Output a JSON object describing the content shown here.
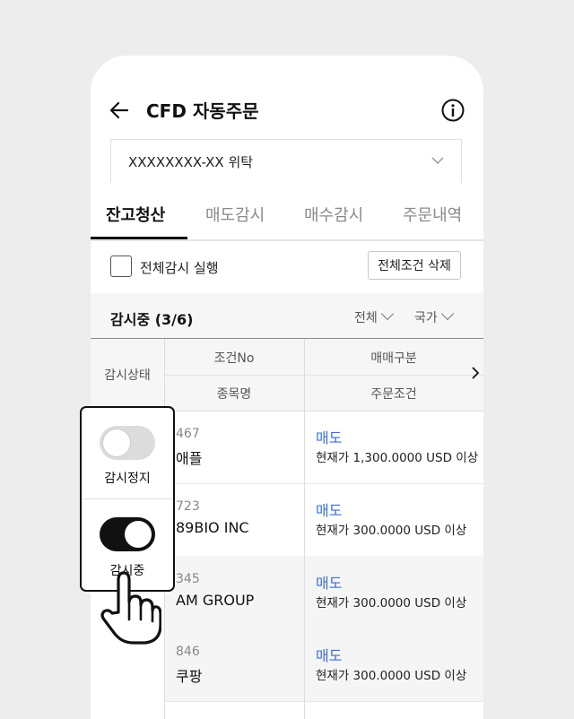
{
  "header": {
    "title": "CFD 자동주문",
    "back_icon": "arrow-left-icon",
    "info_icon": "info-circle-icon"
  },
  "account": {
    "value": "XXXXXXXX-XX 위탁"
  },
  "tabs": [
    {
      "label": "잔고청산",
      "active": true
    },
    {
      "label": "매도감시",
      "active": false
    },
    {
      "label": "매수감시",
      "active": false
    },
    {
      "label": "주문내역",
      "active": false
    }
  ],
  "controls": {
    "checkbox_label": "전체감시 실행",
    "delete_button": "전체조건 삭제"
  },
  "section": {
    "title": "감시중 (3/6)",
    "filter_all": "전체",
    "filter_country": "국가"
  },
  "table": {
    "headers": {
      "status": "감시상태",
      "cond_no": "조건No",
      "trade_type": "매매구분",
      "stock_name": "종목명",
      "order_cond": "주문조건"
    },
    "rows": [
      {
        "no": "467",
        "name": "애플",
        "type": "매도",
        "cond": "현재가 1,300.0000 USD 이상"
      },
      {
        "no": "723",
        "name": "89BIO INC",
        "type": "매도",
        "cond": "현재가 300.0000 USD 이상"
      },
      {
        "no": "345",
        "name": "AM GROUP",
        "type": "매도",
        "cond": "현재가 300.0000 USD 이상"
      },
      {
        "no": "846",
        "name": "쿠팡",
        "type": "매도",
        "cond": "현재가 300.0000 USD 이상"
      }
    ]
  },
  "popup": {
    "off_label": "감시정지",
    "on_label": "감시중"
  },
  "colors": {
    "accent_blue": "#3b6fd8",
    "toggle_on": "#111111",
    "toggle_off": "#dcdcdc"
  }
}
